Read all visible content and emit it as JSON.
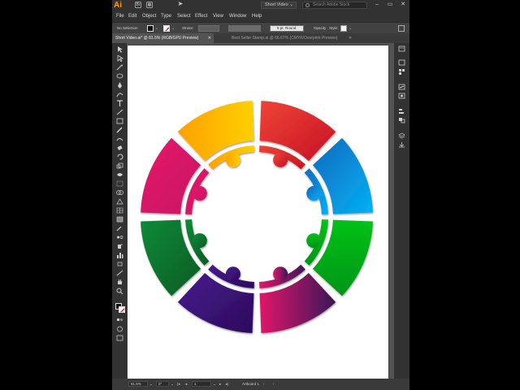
{
  "app": {
    "logo": "Ai"
  },
  "topbar": {
    "workspace": "Short Video",
    "search_placeholder": "Search Adobe Stock",
    "icons": [
      "bridge-icon",
      "layout-grid-icon",
      "send-icon"
    ]
  },
  "menu": [
    "File",
    "Edit",
    "Object",
    "Type",
    "Select",
    "Effect",
    "View",
    "Window",
    "Help"
  ],
  "controlbar": {
    "selection": "No Selection",
    "stroke_label": "Stroke:",
    "stroke_weight": "",
    "brush": "5 pt. Round",
    "opacity_label": "Opacity",
    "style_label": "Style:"
  },
  "tabs": [
    {
      "label": "Short Video.ai* @ 81.5% (RGB/GPU Preview)",
      "active": true
    },
    {
      "label": "Best Seller Stamp.ai @ 66.67% (CMYK/Overprint Preview)",
      "active": false
    }
  ],
  "statusbar": {
    "zoom": "81.5%",
    "rotation": "0°",
    "artboard_number": "1",
    "artboard_name": "Artboard 1"
  },
  "artwork": {
    "description_colors": {
      "orange": [
        "#ffa000",
        "#fdd000"
      ],
      "red": [
        "#ef4436",
        "#c41225"
      ],
      "blue": [
        "#1668c0",
        "#00b2f2"
      ],
      "green_right": [
        "#0fa91c",
        "#009c15"
      ],
      "magenta_bottom": [
        "#e0166a",
        "#3a1458"
      ],
      "purple": [
        "#441684",
        "#2c0e62"
      ],
      "green_left": [
        "#0a7a32",
        "#0e5c26"
      ],
      "pink_left": [
        "#e51b68",
        "#c01060"
      ]
    }
  }
}
